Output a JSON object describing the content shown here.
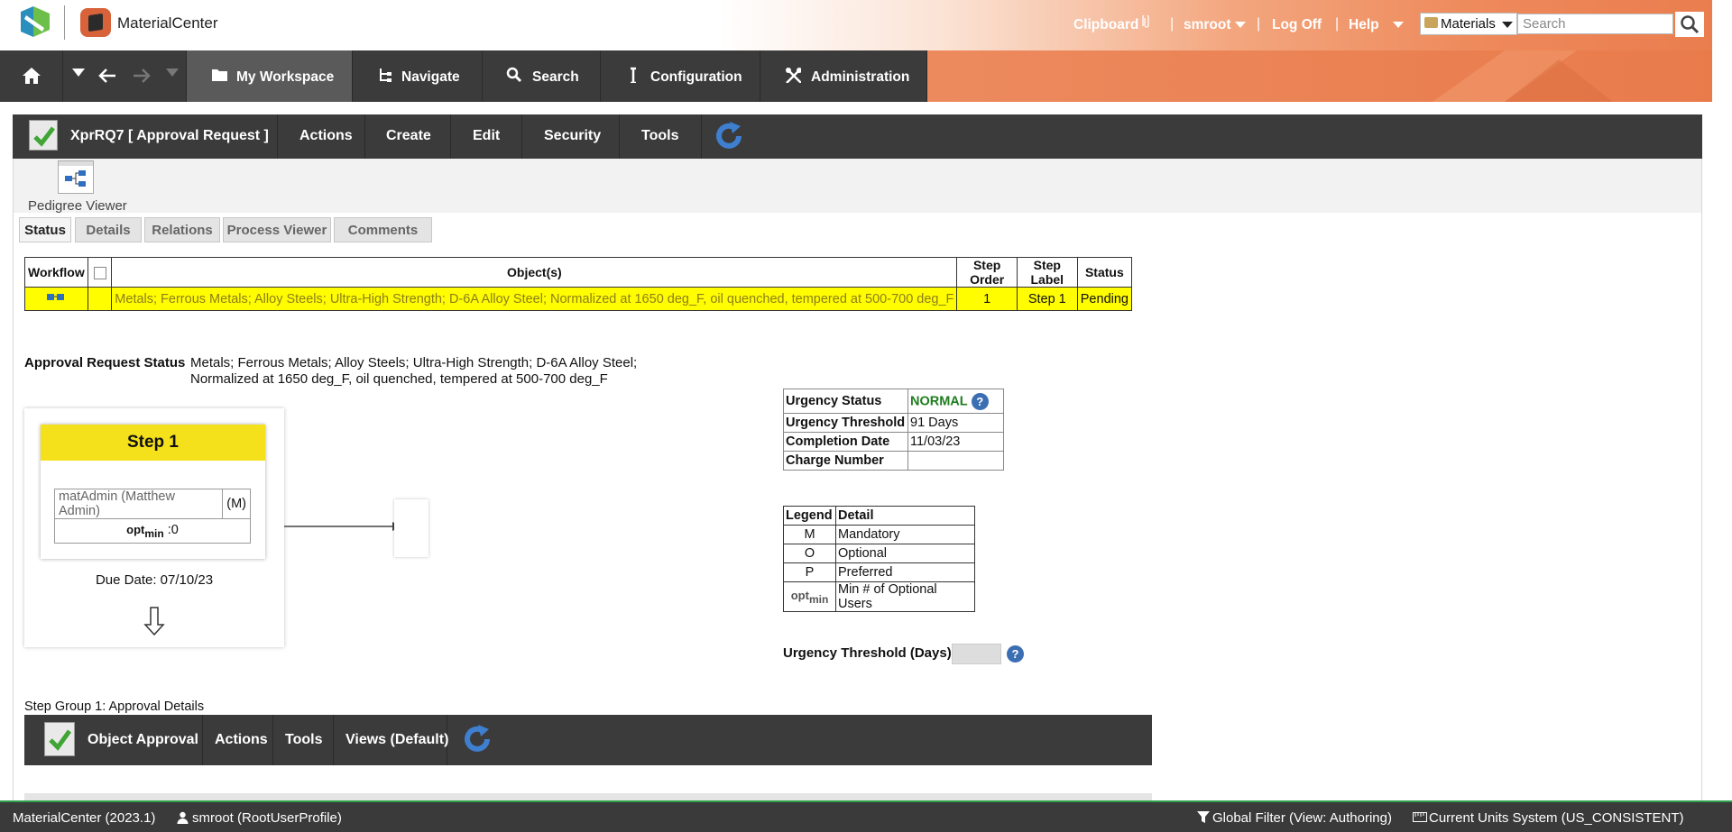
{
  "header": {
    "app_name": "MaterialCenter",
    "clipboard": "Clipboard",
    "user": "smroot",
    "logoff": "Log Off",
    "help": "Help",
    "scope": "Materials",
    "search_placeholder": "Search",
    "sep": "|"
  },
  "nav": {
    "workspace": "My Workspace",
    "navigate": "Navigate",
    "search": "Search",
    "configuration": "Configuration",
    "administration": "Administration"
  },
  "toolbar": {
    "title": "XprRQ7 [ Approval Request ]",
    "actions": "Actions",
    "create": "Create",
    "edit": "Edit",
    "security": "Security",
    "tools": "Tools"
  },
  "viewer": {
    "pedigree": "Pedigree Viewer"
  },
  "tabs": {
    "status": "Status",
    "details": "Details",
    "relations": "Relations",
    "process_viewer": "Process Viewer",
    "comments": "Comments"
  },
  "status_table": {
    "headers": {
      "workflow": "Workflow",
      "objects": "Object(s)",
      "step_order": "Step Order",
      "step_label": "Step Label",
      "status": "Status"
    },
    "row": {
      "object": "Metals; Ferrous Metals; Alloy Steels; Ultra-High Strength; D-6A Alloy Steel; Normalized at 1650 deg_F, oil quenched, tempered at 500-700 deg_F",
      "step_order": "1",
      "step_label": "Step 1",
      "status": "Pending"
    }
  },
  "approval_request": {
    "label": "Approval Request Status",
    "value": "Metals; Ferrous Metals; Alloy Steels; Ultra-High Strength; D-6A Alloy Steel; Normalized at 1650 deg_F, oil quenched, tempered at 500-700 deg_F"
  },
  "step": {
    "title": "Step 1",
    "user": "matAdmin (Matthew Admin)",
    "user_flag": "(M)",
    "opt_main": "opt",
    "opt_sub": "min",
    "opt_value": ":0",
    "due_date": "Due Date: 07/10/23"
  },
  "urgency": {
    "status_label": "Urgency Status",
    "status_value": "NORMAL",
    "threshold_label": "Urgency Threshold",
    "threshold_value": "91 Days",
    "completion_label": "Completion Date",
    "completion_value": "11/03/23",
    "charge_label": "Charge Number",
    "charge_value": "",
    "status_color": "#1e7d1e"
  },
  "legend": {
    "h_legend": "Legend",
    "h_detail": "Detail",
    "rows": [
      {
        "code": "M",
        "detail": "Mandatory"
      },
      {
        "code": "O",
        "detail": "Optional"
      },
      {
        "code": "P",
        "detail": "Preferred"
      },
      {
        "code_main": "opt",
        "code_sub": "min",
        "detail": "Min # of Optional Users"
      }
    ]
  },
  "urgency_threshold_days": {
    "label": "Urgency Threshold (Days)",
    "value": ""
  },
  "step_group": {
    "label": "Step Group 1: Approval Details",
    "title": "Object Approval",
    "actions": "Actions",
    "tools": "Tools",
    "views": "Views (Default)"
  },
  "footer": {
    "version": "MaterialCenter (2023.1)",
    "user": "smroot (RootUserProfile)",
    "filter": "Global Filter (View: Authoring)",
    "units": "Current Units System (US_CONSISTENT)"
  },
  "colors": {
    "accent": "#ea7d4e",
    "toolbar": "#3b3b3b",
    "highlight_row": "#fffd00",
    "step_header": "#f5e11b",
    "footer_line": "#2da24a"
  }
}
